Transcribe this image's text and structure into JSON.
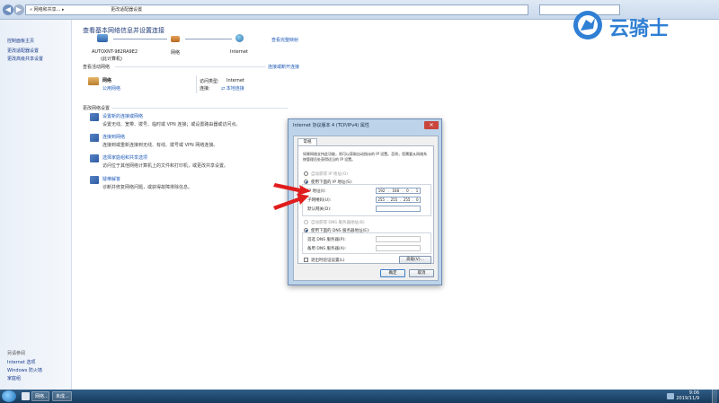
{
  "window": {
    "address": "« 网络和共享... ▸",
    "breadcrumb_tail": "更改适配器设置",
    "nav_back": "◀",
    "nav_fwd": "▶"
  },
  "left_pane": {
    "items": [
      "控制面板主页",
      "更改适配器设置",
      "更改高级共享设置"
    ],
    "see_also": [
      "另请参阅",
      "Internet 选项",
      "Windows 防火墙",
      "家庭组"
    ]
  },
  "main": {
    "title": "查看基本网络信息并设置连接",
    "view_full_map": "查看完整映射",
    "map": {
      "computer": "AUTOXNT-982RA9E2",
      "computer_sub": "(此计算机)",
      "network": "网络",
      "internet": "Internet"
    },
    "active_header": "查看活动网络",
    "connect_disconnect": "连接或断开连接",
    "active": {
      "name": "网络",
      "type": "公用网络",
      "access_type_label": "访问类型:",
      "access_type_value": "Internet",
      "connections_label": "连接:",
      "connections_value": "本地连接"
    },
    "change_header": "更改网络设置",
    "tasks": [
      {
        "title": "设置新的连接或网络",
        "desc": "设置无线、宽带、拨号、临时或 VPN 连接；或设置路由器或访问点。"
      },
      {
        "title": "连接到网络",
        "desc": "连接到或重新连接到无线、有线、拨号或 VPN 网络连接。"
      },
      {
        "title": "选择家庭组和共享选项",
        "desc": "访问位于其他网络计算机上的文件和打印机，或更改共享设置。"
      },
      {
        "title": "疑难解答",
        "desc": "诊断并修复网络问题，或获得故障排除信息。"
      }
    ]
  },
  "dialog": {
    "title": "Internet 协议版本 4 (TCP/IPv4) 属性",
    "close": "✕",
    "tab": "常规",
    "intro": "如果网络支持此功能，则可以获取自动指派的 IP 设置。否则，您需要从网络系统管理员处获得适当的 IP 设置。",
    "auto_ip": "自动获得 IP 地址(O)",
    "manual_ip": "使用下面的 IP 地址(S):",
    "ip_label": "IP 地址(I):",
    "ip_value": [
      "192",
      "168",
      "0",
      "1"
    ],
    "mask_label": "子网掩码(U):",
    "mask_value": [
      "255",
      "255",
      "255",
      "0"
    ],
    "gateway_label": "默认网关(D):",
    "auto_dns": "自动获得 DNS 服务器地址(B)",
    "manual_dns": "使用下面的 DNS 服务器地址(E):",
    "dns1_label": "首选 DNS 服务器(P):",
    "dns2_label": "备用 DNS 服务器(A):",
    "validate": "退出时验证设置(L)",
    "advanced": "高级(V)...",
    "ok": "确定",
    "cancel": "取消"
  },
  "taskbar": {
    "items": [
      "网络...",
      "未成..."
    ],
    "time": "9:06",
    "date": "2019/11/9"
  },
  "watermark": {
    "text": "云骑士",
    "color": "#2f7fd4"
  }
}
